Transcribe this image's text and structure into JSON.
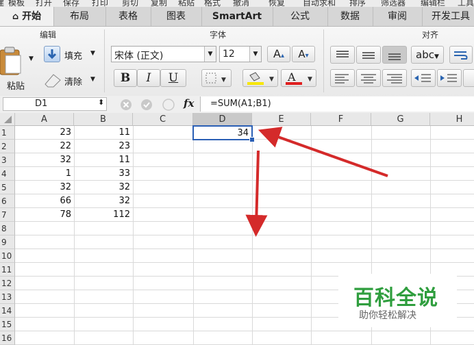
{
  "top_menu": [
    "建",
    "模板",
    "打开",
    "保存",
    "打印",
    "剪切",
    "复制",
    "粘贴",
    "格式",
    "撤消",
    "恢复",
    "自动求和",
    "排序",
    "筛选器",
    "编辑栏",
    "工具"
  ],
  "tabs": [
    "开始",
    "布局",
    "表格",
    "图表",
    "SmartArt",
    "公式",
    "数据",
    "审阅",
    "开发工具"
  ],
  "ribbon": {
    "edit_group": "编辑",
    "font_group": "字体",
    "align_group": "对齐",
    "paste": "粘贴",
    "fill": "填充",
    "clear": "清除",
    "font_name": "宋体 (正文)",
    "font_size": "12",
    "bold": "B",
    "italic": "I",
    "underline": "U",
    "text_style": "abc"
  },
  "formula_bar": {
    "cell_ref": "D1",
    "fx": "fx",
    "formula": "=SUM(A1;B1)"
  },
  "columns": [
    "A",
    "B",
    "C",
    "D",
    "E",
    "F",
    "G",
    "H"
  ],
  "rows": [
    "1",
    "2",
    "3",
    "4",
    "5",
    "6",
    "7",
    "8",
    "9",
    "10",
    "11",
    "12",
    "13",
    "14",
    "15",
    "16"
  ],
  "cells": {
    "A": [
      "23",
      "22",
      "32",
      "1",
      "32",
      "66",
      "78"
    ],
    "B": [
      "11",
      "23",
      "11",
      "33",
      "32",
      "32",
      "112"
    ],
    "D1": "34"
  },
  "watermark": {
    "title": "百科全说",
    "subtitle": "助你轻松解决"
  },
  "colors": {
    "arrow": "#d42a2a",
    "watermark_green": "#2f9e3e",
    "selection": "#2a5fb5"
  }
}
